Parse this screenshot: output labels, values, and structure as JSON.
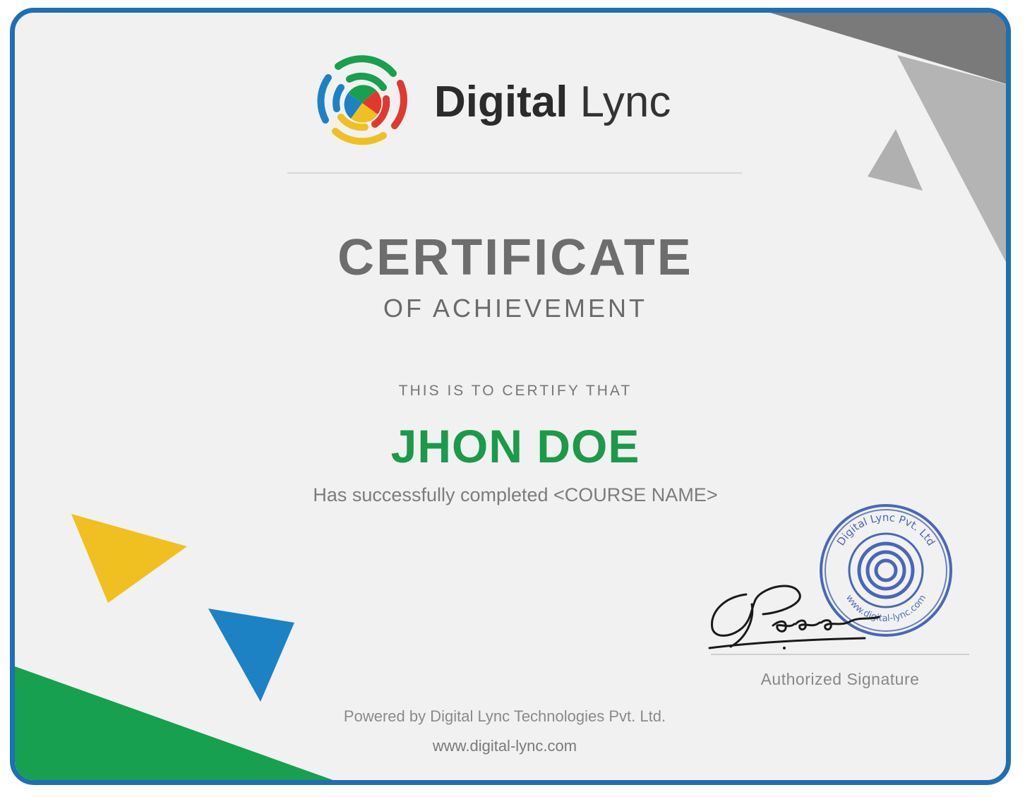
{
  "brand": {
    "name_bold": "Digital",
    "name_light": " Lync"
  },
  "certificate": {
    "title": "CERTIFICATE",
    "subtitle": "OF ACHIEVEMENT",
    "certify_line": "THIS IS TO CERTIFY THAT",
    "recipient": "JHON DOE",
    "completion_text": "Has successfully completed <COURSE NAME>"
  },
  "signature": {
    "label": "Authorized Signature",
    "seal_text": "Digital Lync Pvt. Ltd",
    "seal_text_bottom": "www.digital-lync.com"
  },
  "footer": {
    "powered_by": "Powered by Digital Lync Technologies Pvt. Ltd.",
    "website": "www.digital-lync.com"
  },
  "colors": {
    "border": "#1e6fb4",
    "name_green": "#1a9a4a",
    "accent_yellow": "#f0c020",
    "accent_blue": "#1c82c4",
    "accent_green": "#16a050",
    "accent_red": "#e03a2e",
    "corner_dark_gray": "#7a7a7a",
    "corner_light_gray": "#b4b4b4"
  }
}
